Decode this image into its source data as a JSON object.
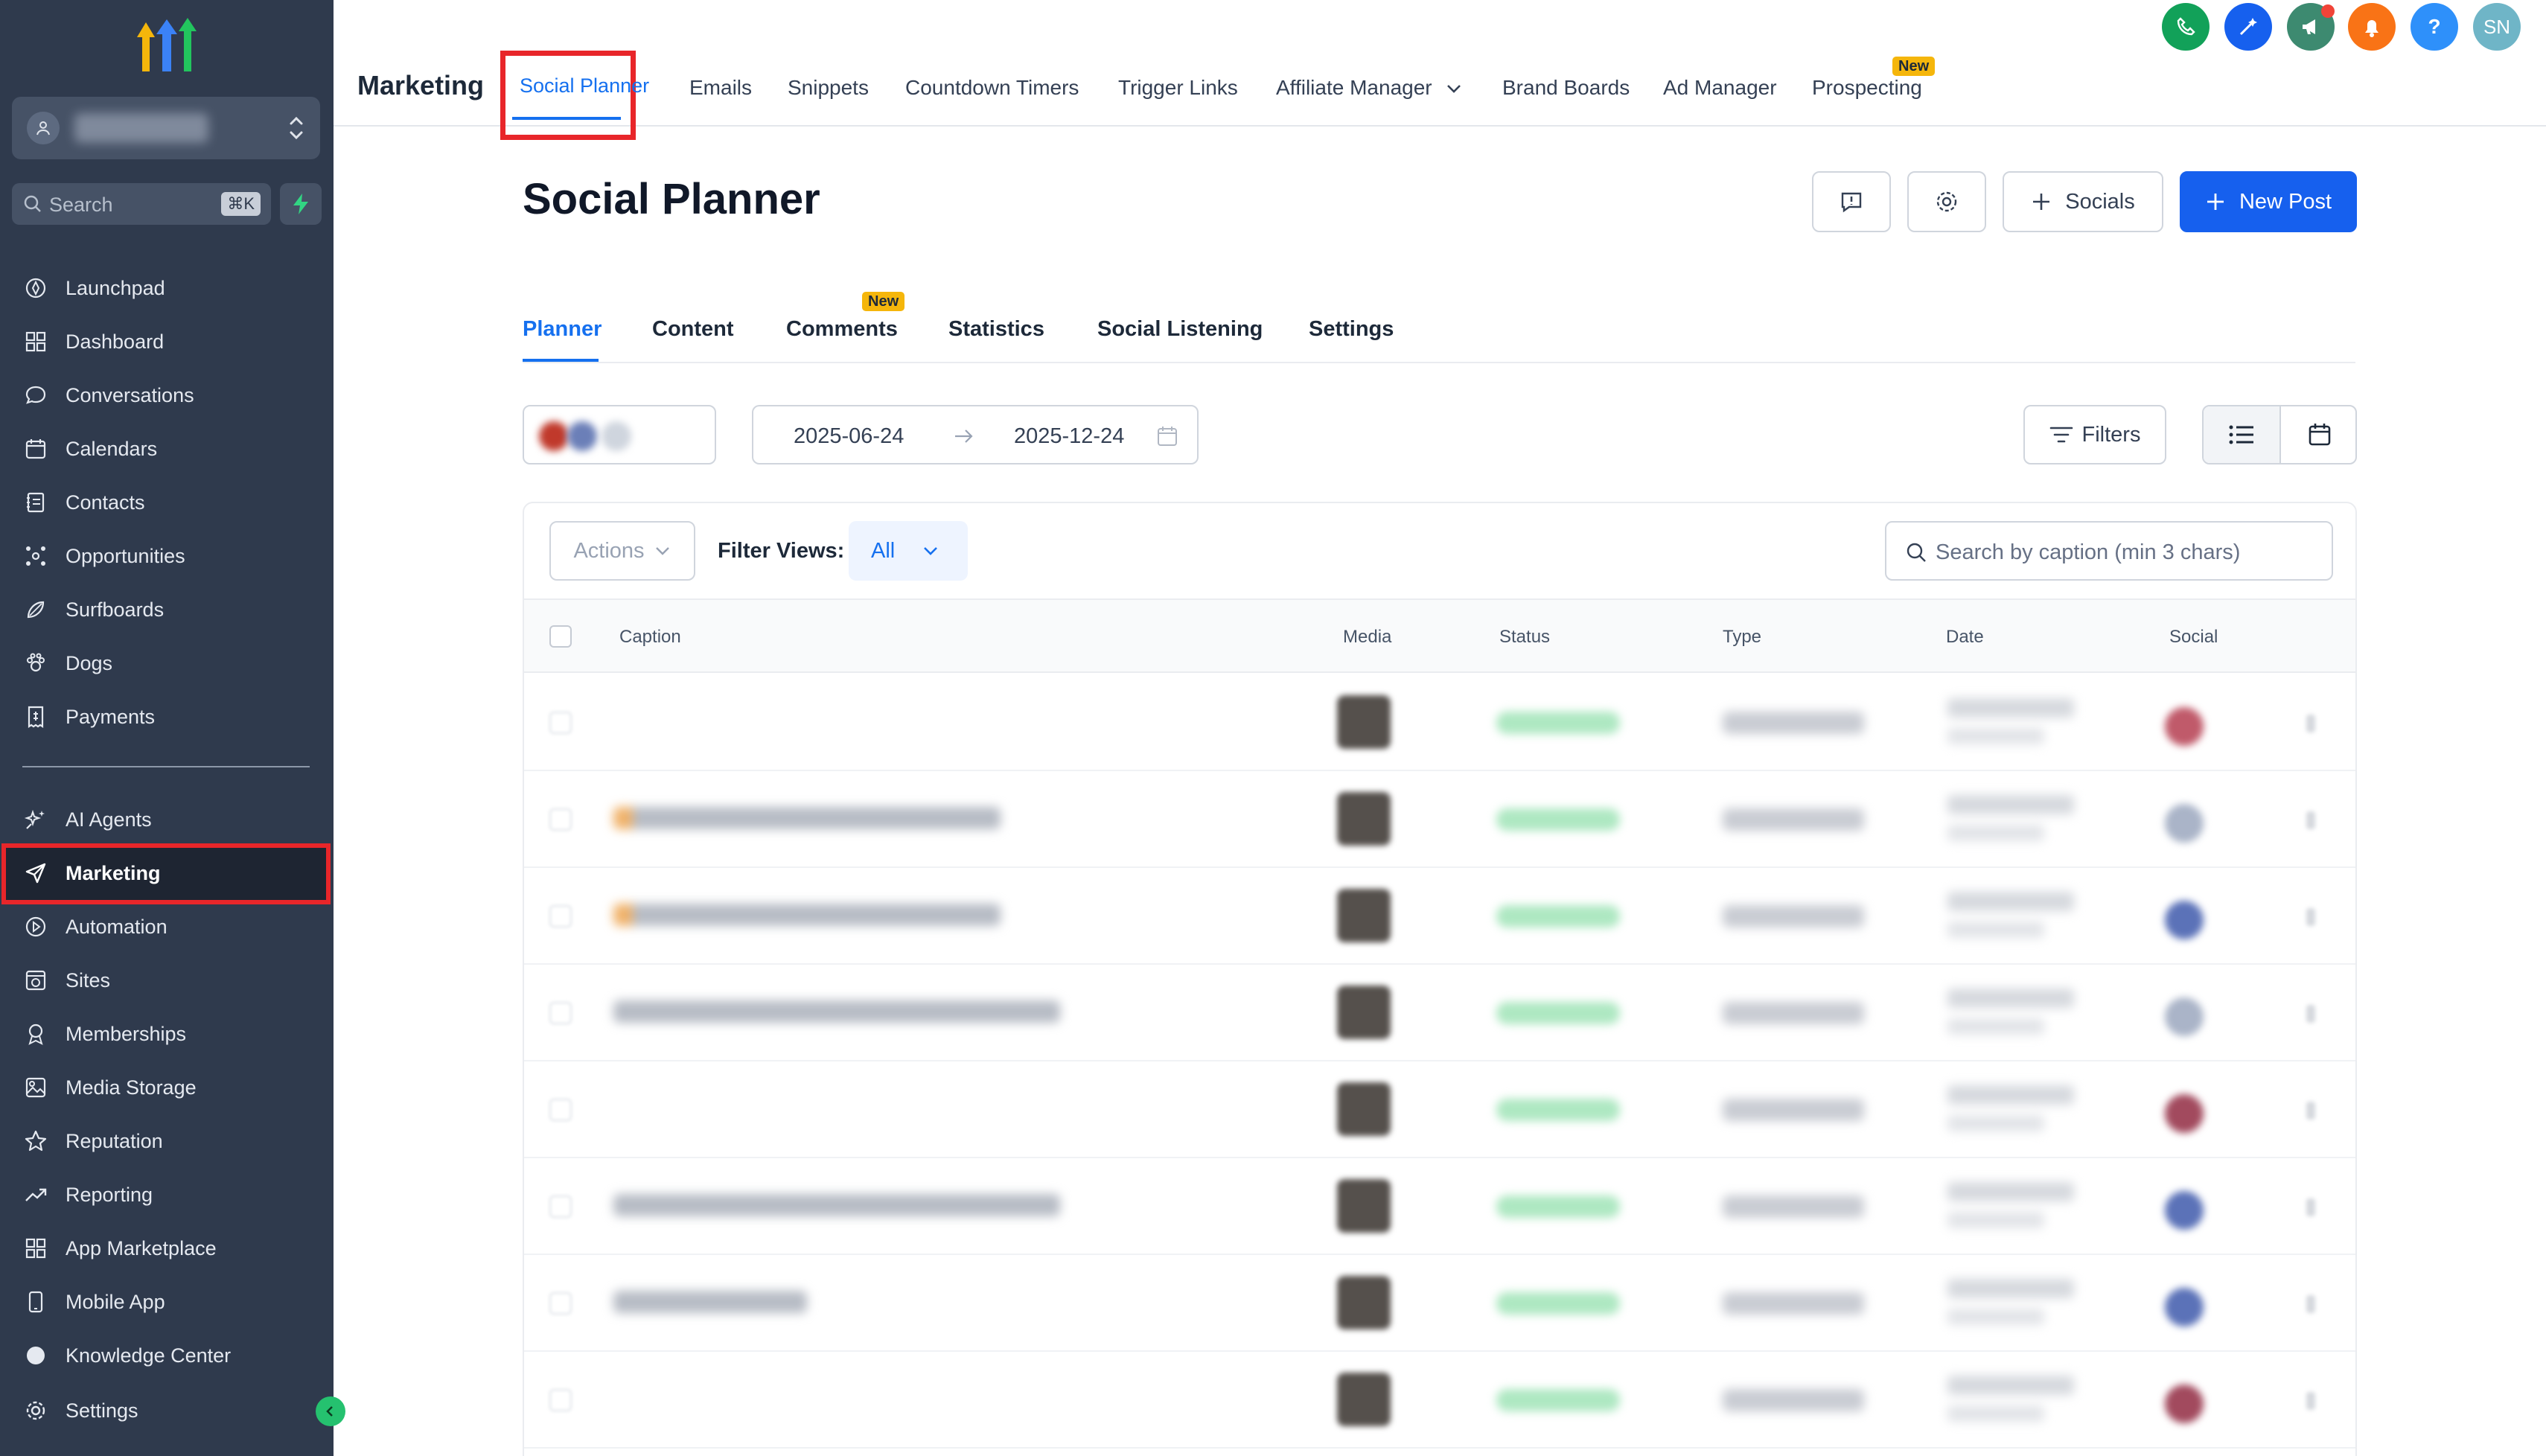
{
  "sidebar": {
    "search_label": "Search",
    "search_shortcut": "⌘K",
    "items": [
      {
        "label": "Launchpad",
        "icon": "rocket-icon"
      },
      {
        "label": "Dashboard",
        "icon": "grid-icon"
      },
      {
        "label": "Conversations",
        "icon": "chat-bubble-icon"
      },
      {
        "label": "Calendars",
        "icon": "calendar-icon"
      },
      {
        "label": "Contacts",
        "icon": "contact-book-icon"
      },
      {
        "label": "Opportunities",
        "icon": "network-icon"
      },
      {
        "label": "Surfboards",
        "icon": "surfboard-icon"
      },
      {
        "label": "Dogs",
        "icon": "paw-icon"
      },
      {
        "label": "Payments",
        "icon": "receipt-icon"
      }
    ],
    "items2": [
      {
        "label": "AI Agents",
        "icon": "sparkle-icon"
      },
      {
        "label": "Marketing",
        "icon": "send-icon",
        "active": true
      },
      {
        "label": "Automation",
        "icon": "play-circle-icon"
      },
      {
        "label": "Sites",
        "icon": "globe-icon"
      },
      {
        "label": "Memberships",
        "icon": "award-icon"
      },
      {
        "label": "Media Storage",
        "icon": "image-icon"
      },
      {
        "label": "Reputation",
        "icon": "star-icon"
      },
      {
        "label": "Reporting",
        "icon": "trend-icon"
      },
      {
        "label": "App Marketplace",
        "icon": "apps-icon"
      },
      {
        "label": "Mobile App",
        "icon": "phone-icon"
      },
      {
        "label": "Knowledge Center",
        "icon": "book-icon"
      }
    ],
    "settings_label": "Settings"
  },
  "topnav": {
    "section": "Marketing",
    "tabs": [
      {
        "label": "Social Planner",
        "active": true
      },
      {
        "label": "Emails"
      },
      {
        "label": "Snippets"
      },
      {
        "label": "Countdown Timers"
      },
      {
        "label": "Trigger Links"
      },
      {
        "label": "Affiliate Manager"
      },
      {
        "label": "Brand Boards"
      },
      {
        "label": "Ad Manager"
      },
      {
        "label": "Prospecting",
        "badge": "New"
      }
    ],
    "user_initials": "SN",
    "help_glyph": "?"
  },
  "page": {
    "title": "Social Planner",
    "socials_button": "Socials",
    "new_post_button": "New Post"
  },
  "subtabs": [
    {
      "label": "Planner",
      "active": true
    },
    {
      "label": "Content"
    },
    {
      "label": "Comments",
      "badge": "New"
    },
    {
      "label": "Statistics"
    },
    {
      "label": "Social Listening"
    },
    {
      "label": "Settings"
    }
  ],
  "filters_bar": {
    "date_from": "2025-06-24",
    "date_to": "2025-12-24",
    "filters_label": "Filters"
  },
  "table": {
    "actions_label": "Actions",
    "filter_views_label": "Filter Views:",
    "filter_views_value": "All",
    "search_placeholder": "Search by caption (min 3 chars)",
    "columns": [
      "Caption",
      "Media",
      "Status",
      "Type",
      "Date",
      "Social"
    ],
    "row_count_visible": 8
  },
  "colors": {
    "sidebar_bg": "#2f3a4d",
    "accent": "#1570ef",
    "primary_button": "#1660ee",
    "highlight_red": "#e8262a",
    "new_badge": "#f5b60b"
  }
}
